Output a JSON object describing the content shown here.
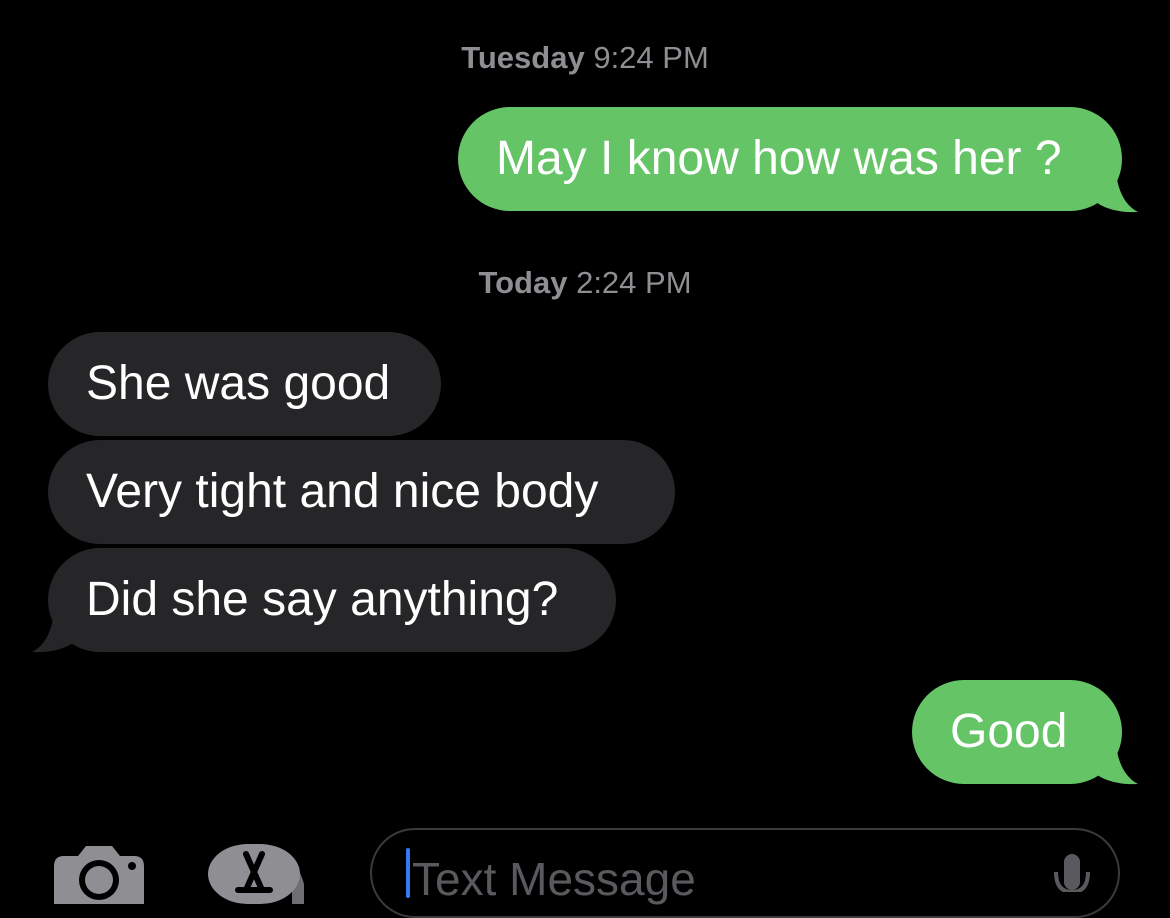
{
  "conversation": {
    "timestamps": [
      {
        "day": "Tuesday",
        "time": "9:24 PM"
      },
      {
        "day": "Today",
        "time": "2:24 PM"
      }
    ],
    "messages": [
      {
        "direction": "sent",
        "text": "May I know how was her ?"
      },
      {
        "direction": "received",
        "text": "She was good"
      },
      {
        "direction": "received",
        "text": "Very tight and nice body"
      },
      {
        "direction": "received",
        "text": "Did she say anything?"
      },
      {
        "direction": "sent",
        "text": "Good"
      }
    ]
  },
  "composer": {
    "placeholder": "Text Message",
    "icons": {
      "camera": "camera-icon",
      "apps": "app-store-icon",
      "mic": "microphone-icon"
    }
  },
  "colors": {
    "background": "#000000",
    "sent_bubble": "#65c466",
    "received_bubble": "#262628",
    "timestamp": "#8e8e93",
    "caret": "#3478f6"
  }
}
